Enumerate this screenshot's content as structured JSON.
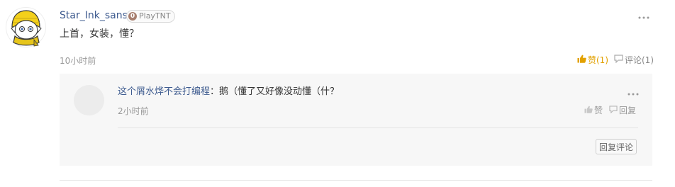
{
  "comment": {
    "username": "Star_Ink_sans",
    "badge_level": "0",
    "badge_text": "PlayTNT",
    "text": "上首，女装，懂？",
    "timestamp": "10小时前",
    "like_label": "赞(1)",
    "reply_label": "评论(1)",
    "like_color": "#e2a100"
  },
  "reply": {
    "username": "这个屑水烨不会打编程",
    "separator": "：",
    "text": "鹅（懂了又好像没动懂（什？",
    "timestamp": "2小时前",
    "like_label": "赞",
    "reply_label": "回复",
    "reply_button_label": "回复评论"
  },
  "icons": {
    "more": "more-dots-icon",
    "like": "thumbs-up-icon",
    "comment": "comment-bubble-icon"
  }
}
